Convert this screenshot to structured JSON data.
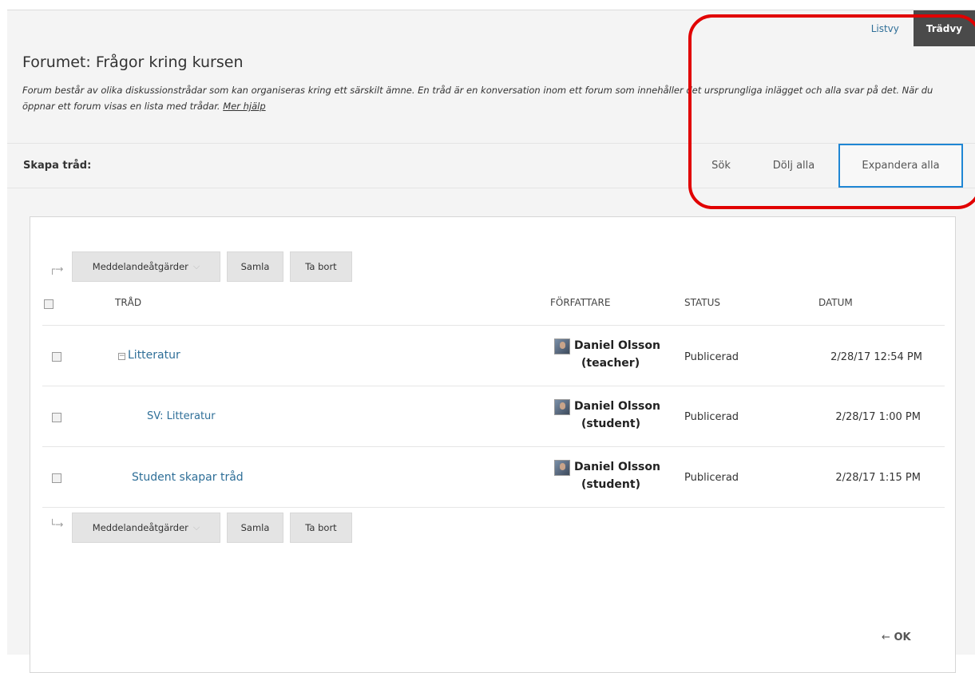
{
  "view_toggle": {
    "list_label": "Listvy",
    "tree_label": "Trädvy"
  },
  "forum": {
    "title": "Forumet: Frågor kring kursen",
    "description": "Forum består av olika diskussionstrådar som kan organiseras kring ett särskilt ämne. En tråd är en konversation inom ett forum som innehåller det ursprungliga inlägget och alla svar på det. När du öppnar ett forum visas en lista med trådar.",
    "help_link": "Mer hjälp"
  },
  "action_bar": {
    "create_label": "Skapa tråd:",
    "search": "Sök",
    "collapse_all": "Dölj alla",
    "expand_all": "Expandera alla"
  },
  "toolbar": {
    "message_actions": "Meddelandeåtgärder",
    "collect": "Samla",
    "delete": "Ta bort"
  },
  "columns": {
    "thread": "TRÅD",
    "author": "FÖRFATTARE",
    "status": "STATUS",
    "date": "DATUM"
  },
  "threads": [
    {
      "title": "Litteratur",
      "author_name": "Daniel Olsson",
      "author_role": "(teacher)",
      "status": "Publicerad",
      "date": "2/28/17 12:54 PM"
    },
    {
      "title": "SV: Litteratur",
      "author_name": "Daniel Olsson",
      "author_role": "(student)",
      "status": "Publicerad",
      "date": "2/28/17 1:00 PM"
    },
    {
      "title": "Student skapar tråd",
      "author_name": "Daniel Olsson",
      "author_role": "(student)",
      "status": "Publicerad",
      "date": "2/28/17 1:15 PM"
    }
  ],
  "footer": {
    "ok_label": "OK",
    "ok_arrow": "←"
  },
  "colors": {
    "link": "#2f6f98",
    "active_tab": "#4a4a4a",
    "highlight_outline": "#e10000",
    "focus_border": "#1f86d4"
  }
}
